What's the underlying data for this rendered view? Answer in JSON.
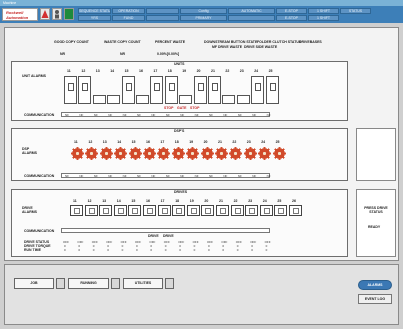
{
  "titlebar": {
    "text": "Machine"
  },
  "header": {
    "logo_line1": "Rockwell",
    "logo_line2": "Automation",
    "top_fields": [
      "SEQUENCE STATUS",
      "OPERATION",
      "",
      "Config",
      "AUTOMATIC",
      "E-STOP",
      "1 SHIFT",
      "STATUS"
    ],
    "bottom_fields": [
      "YRS",
      "FUND",
      "",
      "PRIMARY",
      "",
      "E-STOP",
      "1 SHIFT"
    ]
  },
  "summary": {
    "labels": [
      "GOOD COPY COUNT",
      "WASTE COPY COUNT",
      "PERCENT WASTE",
      "DOWNSTREAM BUTTON STATE",
      "FOLDER CLUTCH STATUS",
      "DRIVEBASES"
    ],
    "sublabels": [
      "MF DRIVE WASTE",
      "DRIVE SIDE WASTE"
    ],
    "values": [
      "NR",
      "NR",
      "0.00%[0.00%]"
    ]
  },
  "units": {
    "title": "UNITS",
    "row_label": "UNIT ALARMS",
    "numbers": [
      "11",
      "12",
      "13",
      "14",
      "15",
      "16",
      "17",
      "18",
      "19",
      "20",
      "21",
      "22",
      "23",
      "24",
      "25"
    ],
    "slot_types": [
      "tall",
      "tall",
      "short",
      "short",
      "tall",
      "short",
      "tall",
      "tall",
      "short",
      "tall",
      "tall",
      "short",
      "short",
      "tall",
      "tall"
    ],
    "alarm_tags": [
      "STOP",
      "GATE",
      "STOP"
    ],
    "comm_label": "COMMUNICATION"
  },
  "dsps": {
    "title": "DSP'S",
    "row_label": "DSP ALARMS",
    "numbers": [
      "11",
      "12",
      "13",
      "14",
      "15",
      "16",
      "17",
      "18",
      "19",
      "20",
      "21",
      "22",
      "23",
      "24",
      "25"
    ],
    "comm_label": "COMMUNICATION"
  },
  "drives": {
    "title": "DRIVES",
    "row_label": "DRIVE ALARMS",
    "numbers": [
      "11",
      "12",
      "13",
      "14",
      "15",
      "16",
      "17",
      "18",
      "19",
      "20",
      "21",
      "22",
      "23",
      "24",
      "25",
      "26"
    ],
    "comm_label": "COMMUNICATION",
    "drive_label": "DRIVE",
    "drive_values": [
      "DRIVE",
      "DRIVE"
    ],
    "status_labels": [
      "DRIVE STATUS",
      "DRIVE TORQUE",
      "RUN TIME"
    ],
    "status_value": "OFF",
    "zero_value": "0",
    "right_label": "PRESS DRIVE STATUS",
    "ready_label": "READY"
  },
  "comm_cell": "NF",
  "bottom": {
    "buttons": [
      "JOB",
      "RUNNING",
      "UTILITIES"
    ],
    "alarms_button": "ALARMS",
    "event_log_button": "EVENT LOG"
  }
}
